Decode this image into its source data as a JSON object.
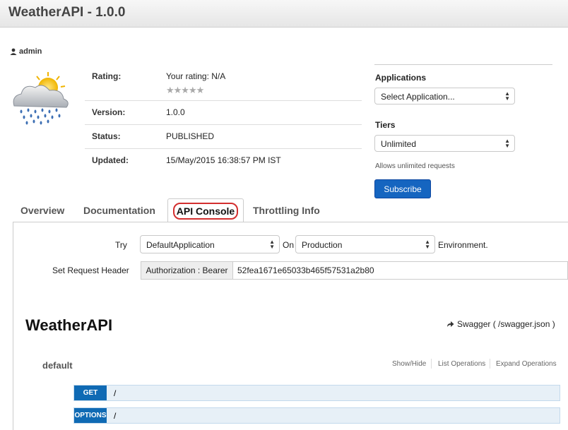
{
  "header": {
    "title": "WeatherAPI - 1.0.0"
  },
  "user": {
    "name": "admin"
  },
  "info": {
    "rating_label": "Rating:",
    "rating_value": "Your rating:  N/A",
    "stars": "★★★★★",
    "version_label": "Version:",
    "version_value": "1.0.0",
    "status_label": "Status:",
    "status_value": "PUBLISHED",
    "updated_label": "Updated:",
    "updated_value": "15/May/2015 16:38:57 PM IST"
  },
  "subscription": {
    "applications_label": "Applications",
    "application_select": "Select Application...",
    "tiers_label": "Tiers",
    "tier_select": "Unlimited",
    "tier_note": "Allows unlimited requests",
    "subscribe_label": "Subscribe"
  },
  "tabs": [
    {
      "label": "Overview"
    },
    {
      "label": "Documentation"
    },
    {
      "label": "API Console",
      "active": true
    },
    {
      "label": "Throttling Info"
    }
  ],
  "console": {
    "try_label": "Try",
    "application_select": "DefaultApplication",
    "on_label": "On",
    "environment_select": "Production",
    "environment_suffix": "Environment.",
    "request_header_label": "Set Request Header",
    "auth_label": "Authorization : Bearer",
    "token": "52fea1671e65033b465f57531a2b80"
  },
  "swagger": {
    "title": "WeatherAPI",
    "link_label": "Swagger ( /swagger.json )",
    "group": "default",
    "show_hide": "Show/Hide",
    "list_operations": "List Operations",
    "expand_operations": "Expand Operations",
    "operations": [
      {
        "method": "GET",
        "path": "/"
      },
      {
        "method": "OPTIONS",
        "path": "/"
      }
    ]
  },
  "colors": {
    "accent": "#1565c0",
    "method_badge": "#0f6ab4",
    "active_tab_outline": "#d32f2f"
  }
}
